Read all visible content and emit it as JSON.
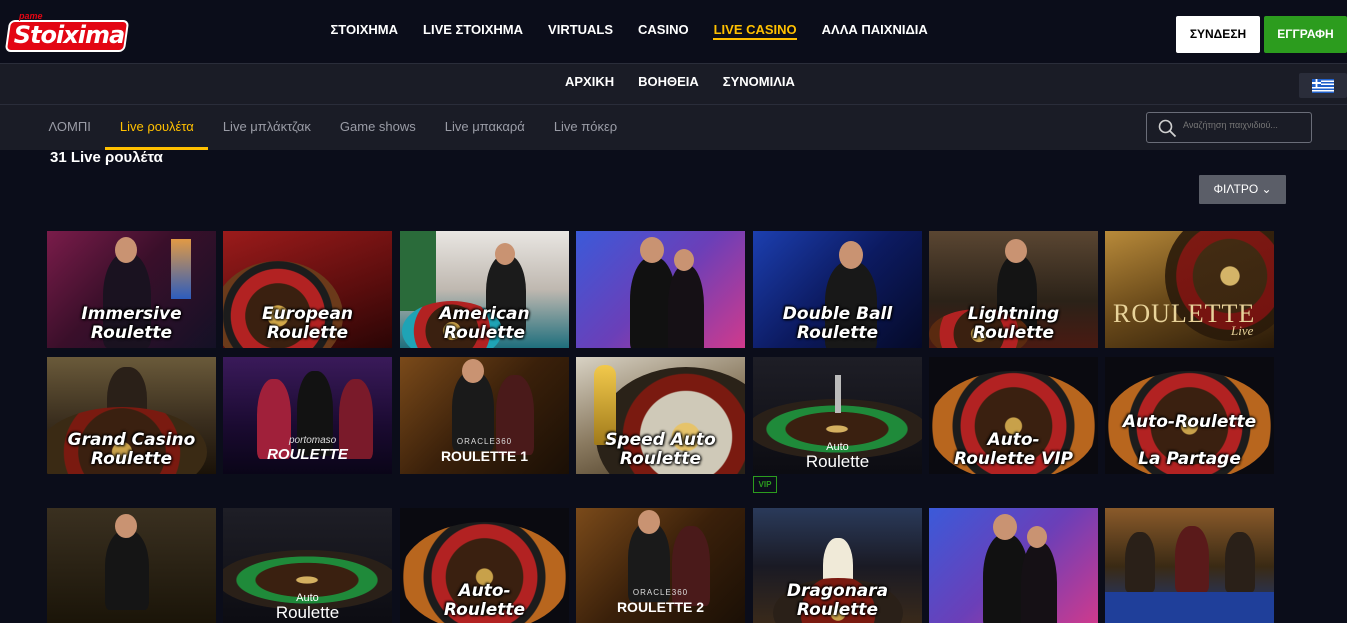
{
  "header": {
    "logo_small": "pame",
    "logo_main": "Stoixima",
    "nav": [
      "ΣΤΟΙΧΗΜΑ",
      "LIVE ΣΤΟΙΧΗΜΑ",
      "VIRTUALS",
      "CASINO",
      "LIVE CASINO",
      "ΑΛΛΑ ΠΑΙΧΝΙΔΙΑ"
    ],
    "active_nav": "LIVE CASINO",
    "login_label": "ΣΥΝΔΕΣΗ",
    "register_label": "ΕΓΓΡΑΦΗ"
  },
  "subnav": {
    "items": [
      "ΑΡΧΙΚΗ",
      "ΒΟΗΘΕΙΑ",
      "ΣΥΝΟΜΙΛΙΑ"
    ],
    "language": "greek-flag-icon"
  },
  "tabs": {
    "items": [
      "ΛΟΜΠΙ",
      "Live ρουλέτα",
      "Live μπλάκτζακ",
      "Game shows",
      "Live μπακαρά",
      "Live πόκερ"
    ],
    "active": "Live ρουλέτα"
  },
  "search": {
    "placeholder": "Αναζήτηση παιχνιδιού..."
  },
  "result_count": "31 Live ρουλέτα",
  "filter_label": "ΦΙΛΤΡΟ ⌄",
  "games": [
    {
      "title": "Immersive Roulette",
      "line1": "Immersive",
      "line2": "Roulette"
    },
    {
      "title": "European Roulette",
      "line1": "European",
      "line2": "Roulette"
    },
    {
      "title": "American Roulette",
      "line1": "American",
      "line2": "Roulette"
    },
    {
      "title": "",
      "line1": "",
      "line2": ""
    },
    {
      "title": "Double Ball Roulette",
      "line1": "Double Ball",
      "line2": "Roulette"
    },
    {
      "title": "Lightning Roulette",
      "line1": "Lightning",
      "line2": "Roulette"
    },
    {
      "title": "Roulette Live",
      "line1": "ROULETTE",
      "line2": "Live"
    },
    {
      "title": "Grand Casino Roulette",
      "line1": "Grand Casino",
      "line2": "Roulette"
    },
    {
      "title": "Portomaso Roulette",
      "line1": "portomaso",
      "line2": "ROULETTE"
    },
    {
      "title": "Oracle360 Roulette 1",
      "line1": "ORACLE360",
      "line2": "ROULETTE 1"
    },
    {
      "title": "Speed Auto Roulette",
      "line1": "Speed Auto",
      "line2": "Roulette"
    },
    {
      "title": "Auto Roulette",
      "line1": "Auto",
      "line2": "Roulette"
    },
    {
      "title": "Auto-Roulette VIP",
      "line1": "Auto-",
      "line2": "Roulette VIP"
    },
    {
      "title": "Auto-Roulette La Partage",
      "line1": "Auto-Roulette",
      "line2": "La Partage"
    },
    {
      "title": "",
      "line1": "",
      "line2": ""
    },
    {
      "title": "Auto Roulette",
      "line1": "Auto",
      "line2": "Roulette"
    },
    {
      "title": "Auto-Roulette",
      "line1": "Auto-",
      "line2": "Roulette"
    },
    {
      "title": "Oracle360 Roulette 2",
      "line1": "ORACLE360",
      "line2": "ROULETTE 2"
    },
    {
      "title": "Dragonara Roulette",
      "line1": "Dragonara",
      "line2": "Roulette"
    },
    {
      "title": "",
      "line1": "",
      "line2": ""
    },
    {
      "title": "",
      "line1": "",
      "line2": ""
    }
  ],
  "vip_badge": "VIP"
}
